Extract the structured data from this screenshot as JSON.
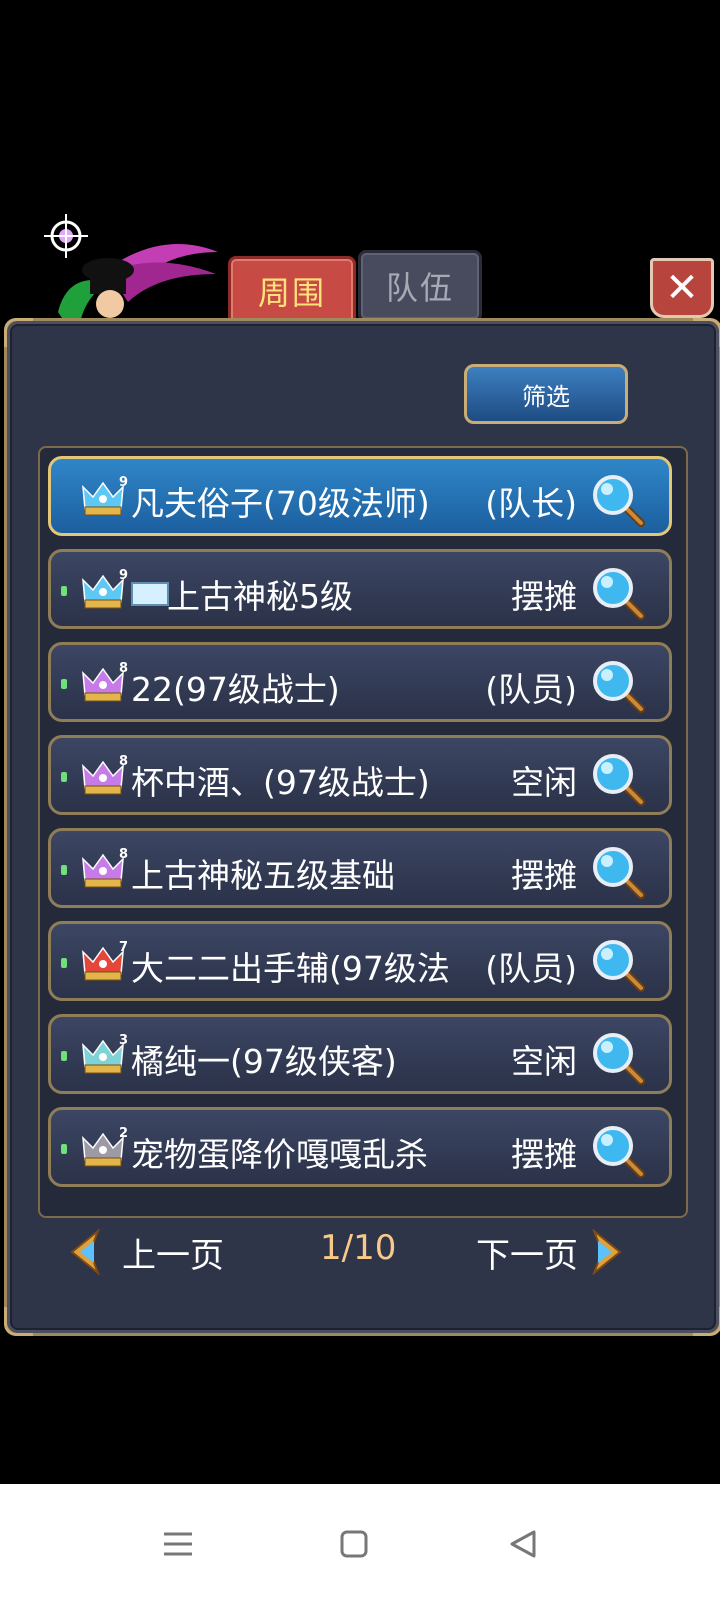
{
  "tabs": [
    {
      "label": "周围",
      "active": true
    },
    {
      "label": "队伍",
      "active": false
    }
  ],
  "close_label": "✕",
  "filter_label": "筛选",
  "players": [
    {
      "crown": "blue",
      "crown_level": "9",
      "name": "凡夫俗子(70级法师)",
      "status": "(队长)",
      "flag": false,
      "selected": true
    },
    {
      "crown": "blue",
      "crown_level": "9",
      "name": "上古神秘5级",
      "status": "摆摊",
      "flag": true,
      "selected": false
    },
    {
      "crown": "purple",
      "crown_level": "8",
      "name": "22(97级战士)",
      "status": "(队员)",
      "flag": false,
      "selected": false
    },
    {
      "crown": "purple",
      "crown_level": "8",
      "name": "杯中酒、(97级战士)",
      "status": "空闲",
      "flag": false,
      "selected": false
    },
    {
      "crown": "purple",
      "crown_level": "8",
      "name": "上古神秘五级基础",
      "status": "摆摊",
      "flag": false,
      "selected": false
    },
    {
      "crown": "red",
      "crown_level": "7",
      "name": "大二二出手辅(97级法",
      "status": "(队员)",
      "flag": false,
      "selected": false
    },
    {
      "crown": "teal",
      "crown_level": "3",
      "name": "橘纯一(97级侠客)",
      "status": "空闲",
      "flag": false,
      "selected": false
    },
    {
      "crown": "gray",
      "crown_level": "2",
      "name": "宠物蛋降价嘎嘎乱杀",
      "status": "摆摊",
      "flag": false,
      "selected": false
    }
  ],
  "pager": {
    "prev": "上一页",
    "next": "下一页",
    "page": "1/10"
  },
  "colors": {
    "crown_blue": "#5ec8f5",
    "crown_purple": "#c77be8",
    "crown_red": "#e4463a",
    "crown_teal": "#7fd3d6",
    "crown_gray": "#9c9aa5",
    "gold": "#e2b64a"
  },
  "nav": {
    "icons": [
      "menu-icon",
      "home-square-icon",
      "back-triangle-icon"
    ]
  }
}
